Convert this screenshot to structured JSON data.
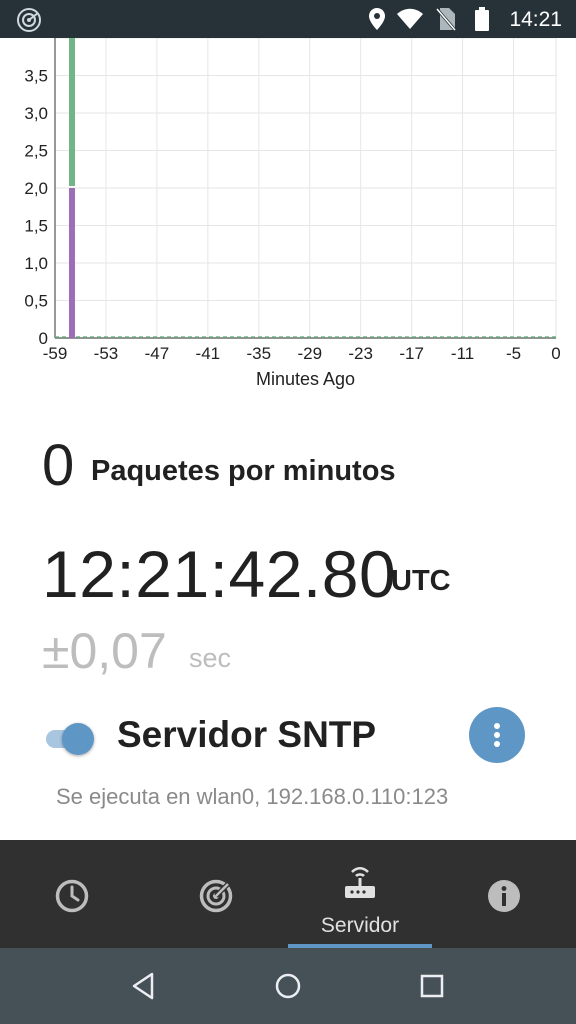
{
  "status_bar": {
    "time": "14:21",
    "icons": [
      "radar-notification-icon",
      "location-icon",
      "wifi-icon",
      "no-sim-icon",
      "battery-icon"
    ]
  },
  "chart_data": {
    "type": "bar",
    "xlabel": "Minutes Ago",
    "ylabel": "",
    "x_ticks": [
      "-59",
      "-53",
      "-47",
      "-41",
      "-35",
      "-29",
      "-23",
      "-17",
      "-11",
      "-5",
      "0"
    ],
    "y_ticks": [
      "0",
      "0,5",
      "1,0",
      "1,5",
      "2,0",
      "2,5",
      "3,0",
      "3,5"
    ],
    "ylim": [
      0,
      4
    ],
    "xlim": [
      -59,
      0
    ],
    "grid": true,
    "stacked": true,
    "series": [
      {
        "color": "#9c6fb5",
        "points": [
          {
            "x": -57,
            "y": 2.0
          }
        ]
      },
      {
        "color": "#72b587",
        "points": [
          {
            "x": -57,
            "y": 2.0
          }
        ]
      }
    ]
  },
  "stats": {
    "packets_count": "0",
    "packets_label": "Paquetes por minutos",
    "time_value": "12:21:42.80",
    "time_zone": "UTC",
    "offset_value": "±0,07",
    "offset_unit": "sec"
  },
  "server": {
    "enabled": true,
    "title": "Servidor SNTP",
    "info": "Se ejecuta en wlan0, 192.168.0.110:123"
  },
  "bottom_nav": {
    "tabs": [
      {
        "icon": "clock-icon",
        "label": ""
      },
      {
        "icon": "radar-icon",
        "label": ""
      },
      {
        "icon": "router-icon",
        "label": "Servidor",
        "active": true
      },
      {
        "icon": "info-icon",
        "label": ""
      }
    ]
  },
  "colors": {
    "accent": "#5e97c6",
    "status_bar": "#263238",
    "bottom_nav": "#303030",
    "system_nav": "#465157"
  }
}
